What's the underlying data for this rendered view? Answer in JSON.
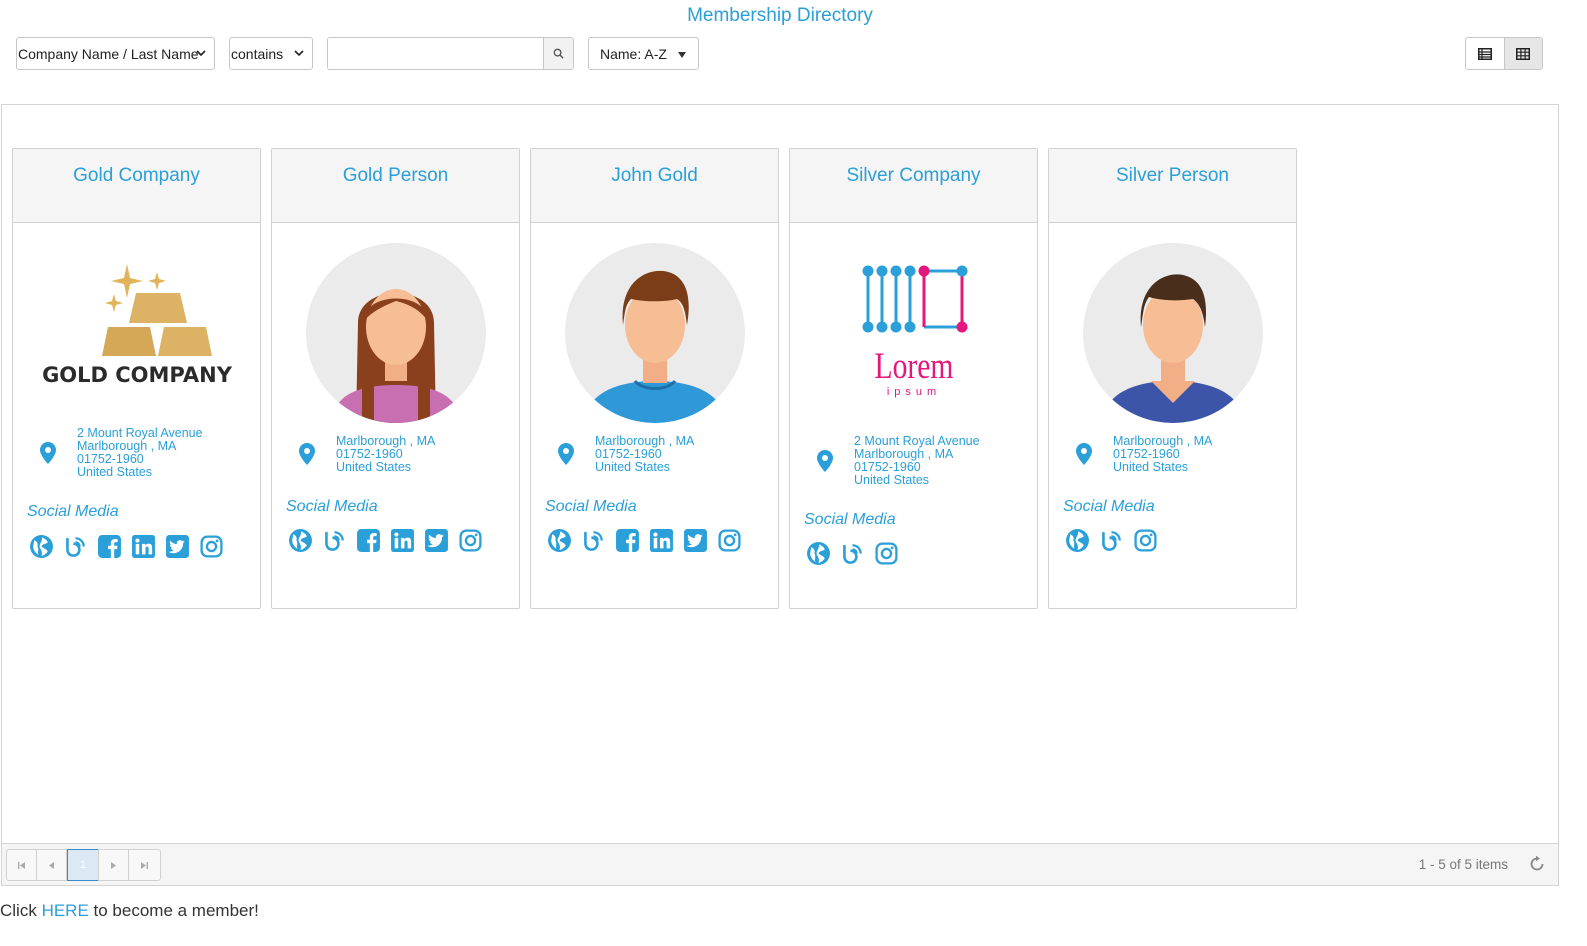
{
  "page": {
    "title": "Membership Directory"
  },
  "toolbar": {
    "field_select": {
      "value": "Company Name / Last Name",
      "icon": "chevron-down-icon"
    },
    "operator_select": {
      "value": "contains",
      "icon": "chevron-down-icon"
    },
    "search": {
      "value": "",
      "placeholder": "",
      "icon": "search-icon"
    },
    "sort": {
      "label": "Name: A-Z",
      "icon": "caret-down-icon"
    },
    "views": [
      {
        "name": "list-view",
        "icon": "list-icon",
        "active": false
      },
      {
        "name": "grid-view",
        "icon": "grid-icon",
        "active": true
      }
    ]
  },
  "members": [
    {
      "name": "Gold Company",
      "image": "gold-company-logo",
      "logo_text": "GOLD COMPANY",
      "address": [
        "2 Mount Royal Avenue",
        "Marlborough , MA",
        "01752-1960",
        "United States"
      ],
      "social_label": "Social Media",
      "social": [
        "globe-icon",
        "blog-icon",
        "facebook-icon",
        "linkedin-icon",
        "twitter-icon",
        "instagram-icon"
      ]
    },
    {
      "name": "Gold Person",
      "image": "female-avatar",
      "address": [
        "Marlborough , MA",
        "01752-1960",
        "United States"
      ],
      "social_label": "Social Media",
      "social": [
        "globe-icon",
        "blog-icon",
        "facebook-icon",
        "linkedin-icon",
        "twitter-icon",
        "instagram-icon"
      ]
    },
    {
      "name": "John Gold",
      "image": "male-avatar-blue",
      "address": [
        "Marlborough , MA",
        "01752-1960",
        "United States"
      ],
      "social_label": "Social Media",
      "social": [
        "globe-icon",
        "blog-icon",
        "facebook-icon",
        "linkedin-icon",
        "twitter-icon",
        "instagram-icon"
      ]
    },
    {
      "name": "Silver Company",
      "image": "lorem-ipsum-logo",
      "logo_text": "Lorem",
      "logo_subtext": "ipsum",
      "address": [
        "2 Mount Royal Avenue",
        "Marlborough , MA",
        "01752-1960",
        "United States"
      ],
      "social_label": "Social Media",
      "social": [
        "globe-icon",
        "blog-icon",
        "instagram-icon"
      ]
    },
    {
      "name": "Silver Person",
      "image": "male-avatar-navy",
      "address": [
        "Marlborough , MA",
        "01752-1960",
        "United States"
      ],
      "social_label": "Social Media",
      "social": [
        "globe-icon",
        "blog-icon",
        "instagram-icon"
      ]
    }
  ],
  "pager": {
    "current_page": "1",
    "info": "1 - 5 of 5 items"
  },
  "footer": {
    "prefix": "Click ",
    "link": "HERE",
    "suffix": " to become a member!"
  },
  "colors": {
    "accent": "#2a9fd8",
    "gold": "#d9ad5c",
    "magenta": "#e3177e"
  }
}
